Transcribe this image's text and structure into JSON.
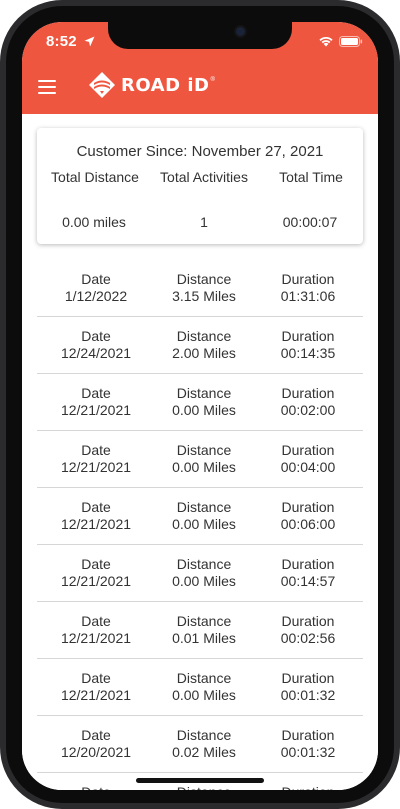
{
  "status_bar": {
    "time": "8:52"
  },
  "header": {
    "logo_text": "ROAD iD",
    "logo_mark": "®",
    "brand_color": "#ef5640"
  },
  "summary": {
    "customer_since": "Customer Since: November 27, 2021",
    "total_distance_label": "Total Distance",
    "total_activities_label": "Total Activities",
    "total_time_label": "Total Time",
    "total_distance_value": "0.00 miles",
    "total_activities_value": "1",
    "total_time_value": "00:00:07"
  },
  "activity_labels": {
    "date": "Date",
    "distance": "Distance",
    "duration": "Duration"
  },
  "activities": [
    {
      "date": "1/12/2022",
      "distance": "3.15 Miles",
      "duration": "01:31:06"
    },
    {
      "date": "12/24/2021",
      "distance": "2.00 Miles",
      "duration": "00:14:35"
    },
    {
      "date": "12/21/2021",
      "distance": "0.00 Miles",
      "duration": "00:02:00"
    },
    {
      "date": "12/21/2021",
      "distance": "0.00 Miles",
      "duration": "00:04:00"
    },
    {
      "date": "12/21/2021",
      "distance": "0.00 Miles",
      "duration": "00:06:00"
    },
    {
      "date": "12/21/2021",
      "distance": "0.00 Miles",
      "duration": "00:14:57"
    },
    {
      "date": "12/21/2021",
      "distance": "0.01 Miles",
      "duration": "00:02:56"
    },
    {
      "date": "12/21/2021",
      "distance": "0.00 Miles",
      "duration": "00:01:32"
    },
    {
      "date": "12/20/2021",
      "distance": "0.02 Miles",
      "duration": "00:01:32"
    },
    {
      "date": "",
      "distance": "",
      "duration": ""
    }
  ],
  "icons": {
    "status": [
      "location-arrow-icon",
      "wifi-icon",
      "battery-icon"
    ],
    "header": [
      "menu-icon",
      "road-id-logo-icon"
    ]
  }
}
